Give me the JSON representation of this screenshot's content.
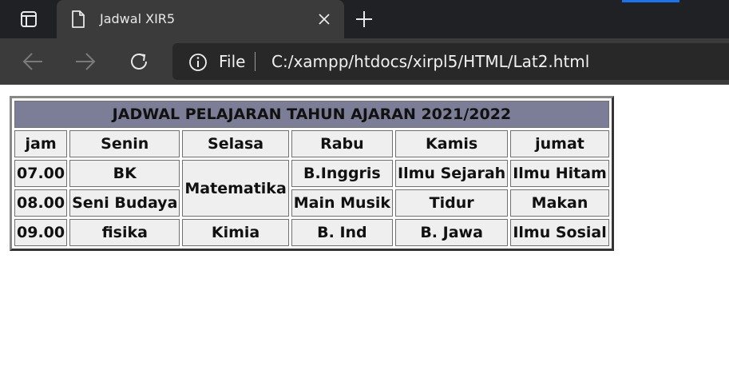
{
  "browser": {
    "tab_title": "Jadwal XIR5",
    "scheme": "File",
    "url": "C:/xampp/htdocs/xirpl5/HTML/Lat2.html",
    "colors": {
      "tabbar": "#202124",
      "toolbar": "#3b3b3b",
      "accent": "#1a73e8"
    }
  },
  "table": {
    "title": "JADWAL PELAJARAN TAHUN AJARAN 2021/2022",
    "headers": [
      "jam",
      "Senin",
      "Selasa",
      "Rabu",
      "Kamis",
      "jumat"
    ],
    "rows": [
      {
        "jam": "07.00",
        "senin": "BK",
        "selasa": "Matematika",
        "rabu": "B.Inggris",
        "kamis": "Ilmu Sejarah",
        "jumat": "Ilmu Hitam"
      },
      {
        "jam": "08.00",
        "senin": "Seni Budaya",
        "rabu": "Main Musik",
        "kamis": "Tidur",
        "jumat": "Makan"
      },
      {
        "jam": "09.00",
        "senin": "fisika",
        "selasa": "Kimia",
        "rabu": "B. Ind",
        "kamis": "B. Jawa",
        "jumat": "Ilmu Sosial"
      }
    ],
    "colors": {
      "title_bg": "#7b7e96",
      "cell_bg": "#efefef"
    }
  }
}
